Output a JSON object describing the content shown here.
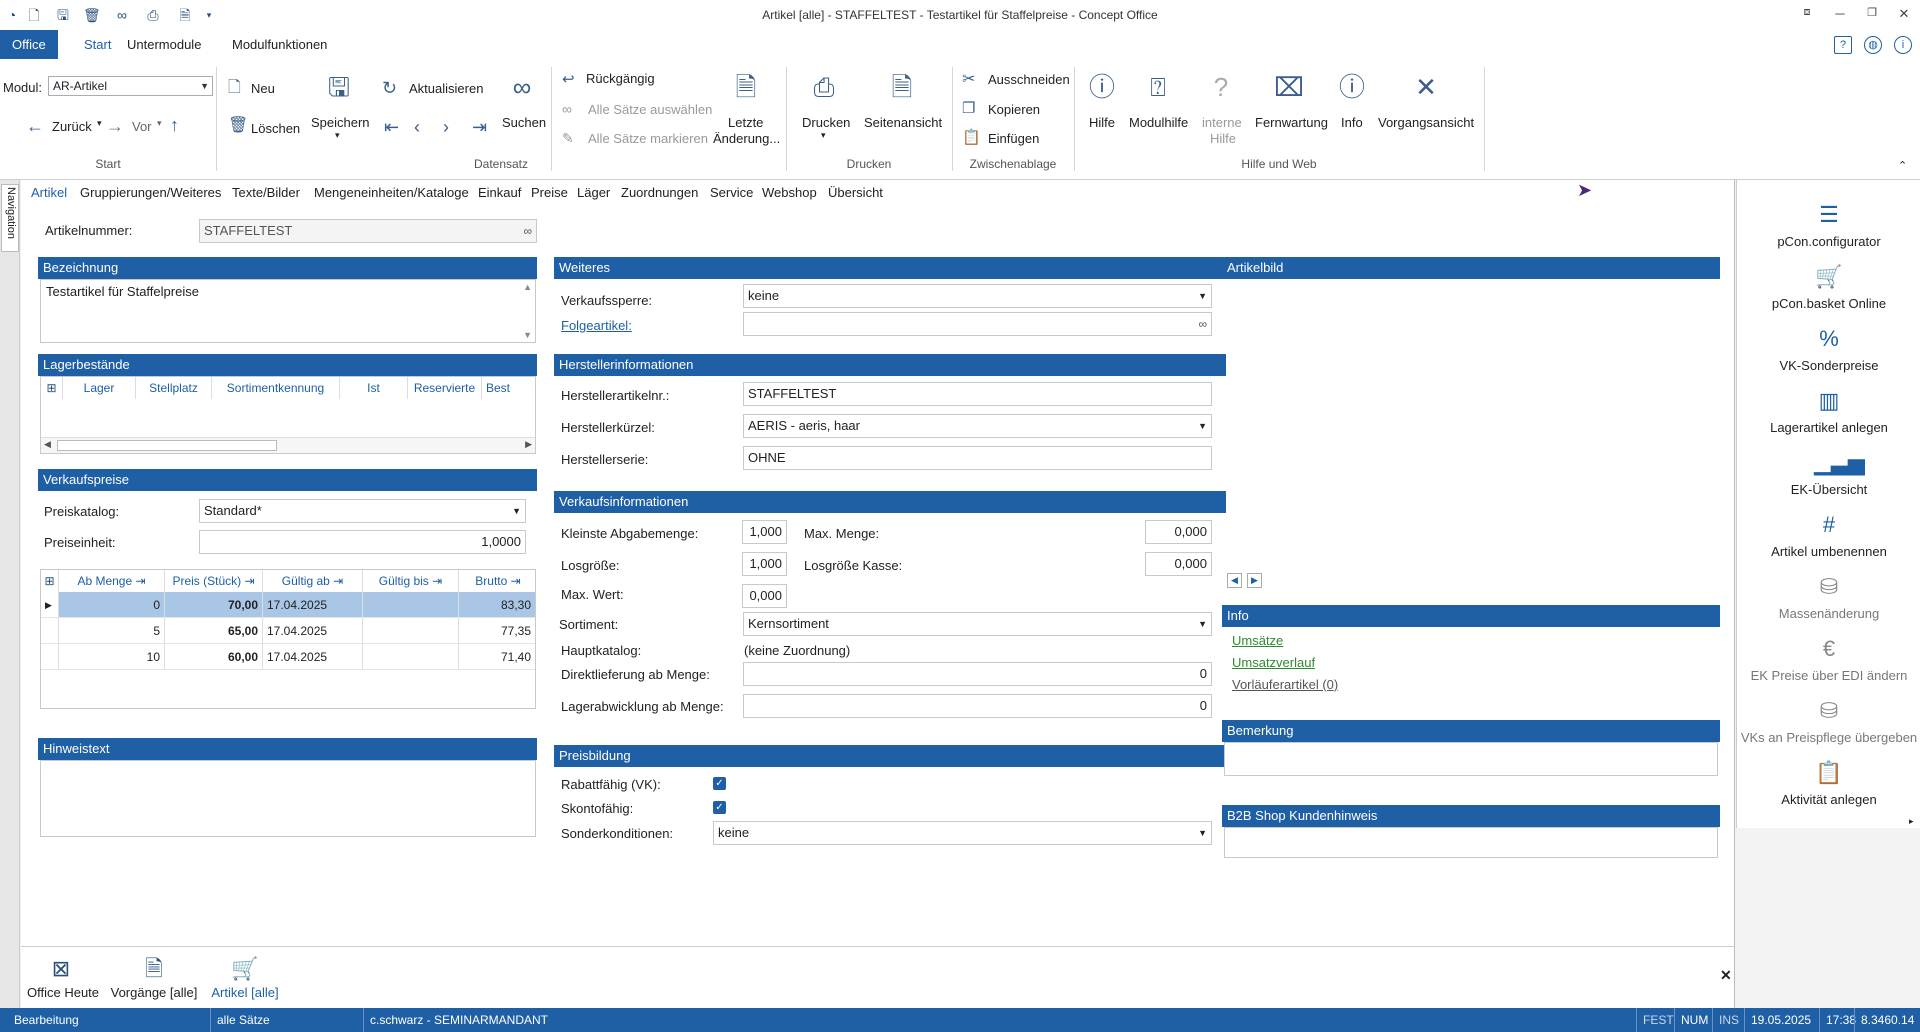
{
  "window": {
    "title": "Artikel [alle] - STAFFELTEST - Testartikel für Staffelpreise - Concept Office"
  },
  "ribbon_tabs": [
    "Office",
    "Start",
    "Untermodule",
    "Modulfunktionen"
  ],
  "ribbon": {
    "modul_label": "Modul:",
    "modul_value": "AR-Artikel",
    "neu": "Neu",
    "loeschen": "Löschen",
    "zurueck": "Zurück",
    "vor": "Vor",
    "speichern": "Speichern",
    "aktualisieren": "Aktualisieren",
    "suchen": "Suchen",
    "rueckgaengig": "Rückgängig",
    "alle_auswaehlen": "Alle Sätze auswählen",
    "alle_markieren": "Alle Sätze markieren",
    "letzte_1": "Letzte",
    "letzte_2": "Änderung...",
    "drucken": "Drucken",
    "seitenansicht": "Seitenansicht",
    "ausschneiden": "Ausschneiden",
    "kopieren": "Kopieren",
    "einfuegen": "Einfügen",
    "hilfe": "Hilfe",
    "modulhilfe": "Modulhilfe",
    "interne_1": "interne",
    "interne_2": "Hilfe",
    "fernwartung": "Fernwartung",
    "info": "Info",
    "vorgangsansicht": "Vorgangsansicht",
    "groups": {
      "start": "Start",
      "datensatz": "Datensatz",
      "drucken": "Drucken",
      "zwischenablage": "Zwischenablage",
      "hilfe_web": "Hilfe und Web"
    }
  },
  "nav_label": "Navigation",
  "form_tabs": [
    "Artikel",
    "Gruppierungen/Weiteres",
    "Texte/Bilder",
    "Mengeneinheiten/Kataloge",
    "Einkauf",
    "Preise",
    "Läger",
    "Zuordnungen",
    "Service",
    "Webshop",
    "Übersicht"
  ],
  "artikelnummer": {
    "label": "Artikelnummer:",
    "value": "STAFFELTEST"
  },
  "bezeichnung": {
    "header": "Bezeichnung",
    "value": "Testartikel für Staffelpreise"
  },
  "lagerbestaende": {
    "header": "Lagerbestände",
    "columns": [
      "Lager",
      "Stellplatz",
      "Sortimentkennung",
      "Ist",
      "Reservierte",
      "Best"
    ]
  },
  "verkaufspreise": {
    "header": "Verkaufspreise",
    "preiskatalog_label": "Preiskatalog:",
    "preiskatalog_value": "Standard*",
    "preiseinheit_label": "Preiseinheit:",
    "preiseinheit_value": "1,0000",
    "columns": [
      "Ab Menge",
      "Preis (Stück)",
      "Gültig ab",
      "Gültig bis",
      "Brutto"
    ],
    "rows": [
      [
        "0",
        "70,00",
        "17.04.2025",
        "",
        "83,30"
      ],
      [
        "5",
        "65,00",
        "17.04.2025",
        "",
        "77,35"
      ],
      [
        "10",
        "60,00",
        "17.04.2025",
        "",
        "71,40"
      ]
    ]
  },
  "hinweistext": {
    "header": "Hinweistext"
  },
  "weiteres": {
    "header": "Weiteres",
    "verkaufssperre_label": "Verkaufssperre:",
    "verkaufssperre_value": "keine",
    "folgeartikel_label": "Folgeartikel:"
  },
  "hersteller": {
    "header": "Herstellerinformationen",
    "artikelnr_label": "Herstellerartikelnr.:",
    "artikelnr_value": "STAFFELTEST",
    "kuerzel_label": "Herstellerkürzel:",
    "kuerzel_value": "AERIS - aeris, haar",
    "serie_label": "Herstellerserie:",
    "serie_value": "OHNE"
  },
  "verkaufsinfo": {
    "header": "Verkaufsinformationen",
    "kleinste_label": "Kleinste Abgabemenge:",
    "kleinste_value": "1,000",
    "maxmenge_label": "Max. Menge:",
    "maxmenge_value": "0,000",
    "losgroesse_label": "Losgröße:",
    "losgroesse_value": "1,000",
    "losgroesse_kasse_label": "Losgröße Kasse:",
    "losgroesse_kasse_value": "0,000",
    "maxwert_label": "Max. Wert:",
    "maxwert_value": "0,000",
    "sortiment_label": "Sortiment:",
    "sortiment_value": "Kernsortiment",
    "hauptkatalog_label": "Hauptkatalog:",
    "hauptkatalog_value": "(keine Zuordnung)",
    "direkt_label": "Direktlieferung ab Menge:",
    "direkt_value": "0",
    "lager_label": "Lagerabwicklung ab Menge:",
    "lager_value": "0"
  },
  "preisbildung": {
    "header": "Preisbildung",
    "rabatt_label": "Rabattfähig (VK):",
    "rabatt_checked": true,
    "skonto_label": "Skontofähig:",
    "skonto_checked": true,
    "sonder_label": "Sonderkonditionen:",
    "sonder_value": "keine"
  },
  "artikelbild": {
    "header": "Artikelbild"
  },
  "info": {
    "header": "Info",
    "links": [
      "Umsätze",
      "Umsatzverlauf",
      "Vorläuferartikel (0)"
    ]
  },
  "bemerkung": {
    "header": "Bemerkung"
  },
  "b2b": {
    "header": "B2B Shop Kundenhinweis"
  },
  "right_actions": [
    "pCon.configurator",
    "pCon.basket Online",
    "VK-Sonderpreise",
    "Lagerartikel anlegen",
    "EK-Übersicht",
    "Artikel umbenennen",
    "Massenänderung",
    "EK Preise über EDI ändern",
    "VKs an Preispflege übergeben",
    "Aktivität anlegen"
  ],
  "tray": [
    "Office Heute",
    "Vorgänge [alle]",
    "Artikel [alle]"
  ],
  "status": {
    "mode": "Bearbeitung",
    "filter": "alle Sätze",
    "user": "c.schwarz - SEMINARMANDANT",
    "fest": "FEST",
    "num": "NUM",
    "ins": "INS",
    "date": "19.05.2025",
    "time": "17:38",
    "version": "8.3460.14"
  }
}
